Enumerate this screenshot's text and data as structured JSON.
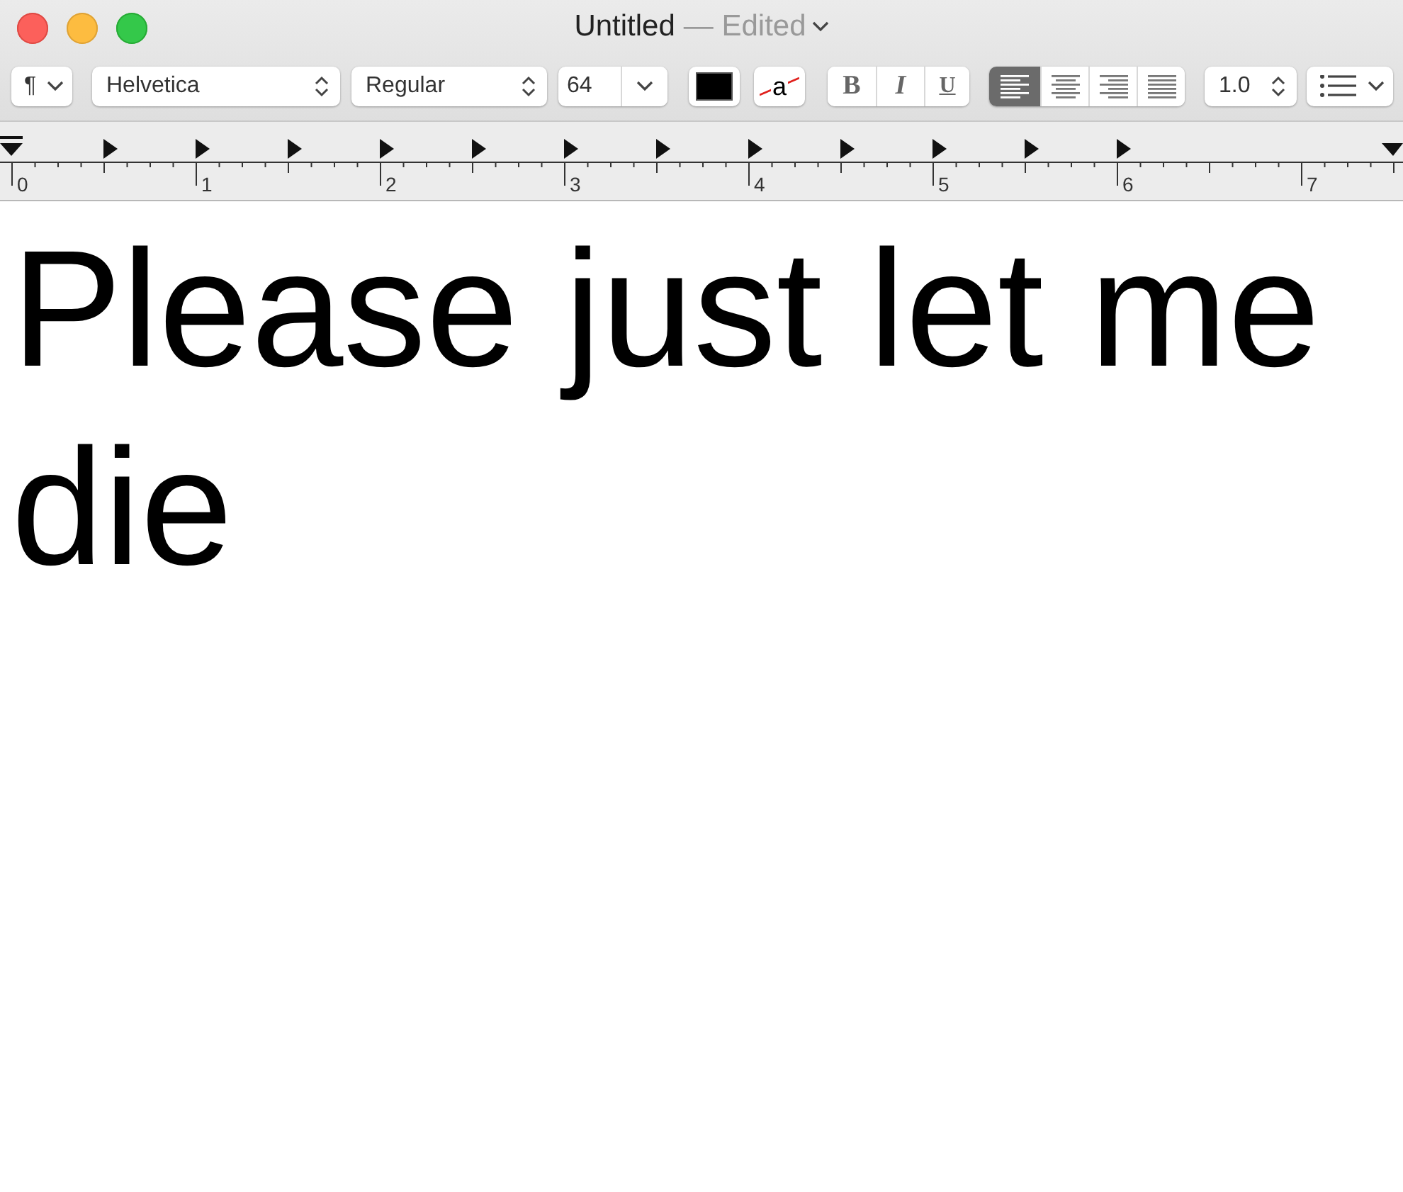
{
  "window": {
    "title": "Untitled",
    "status": "— Edited"
  },
  "toolbar": {
    "paragraph_style": "¶",
    "font_family": "Helvetica",
    "typeface": "Regular",
    "font_size": "64",
    "highlight_sample": "a",
    "styles": [
      {
        "kind": "bold",
        "label": "B"
      },
      {
        "kind": "italic",
        "label": "I"
      },
      {
        "kind": "underline",
        "label": "U"
      }
    ],
    "alignments": [
      {
        "kind": "left",
        "selected": true
      },
      {
        "kind": "center",
        "selected": false
      },
      {
        "kind": "right",
        "selected": false
      },
      {
        "kind": "justify",
        "selected": false
      }
    ],
    "line_spacing": "1.0"
  },
  "ruler": {
    "labels": [
      "0",
      "1",
      "2",
      "3",
      "4",
      "5",
      "6",
      "7"
    ]
  },
  "document": {
    "text": "Please just let me die"
  }
}
